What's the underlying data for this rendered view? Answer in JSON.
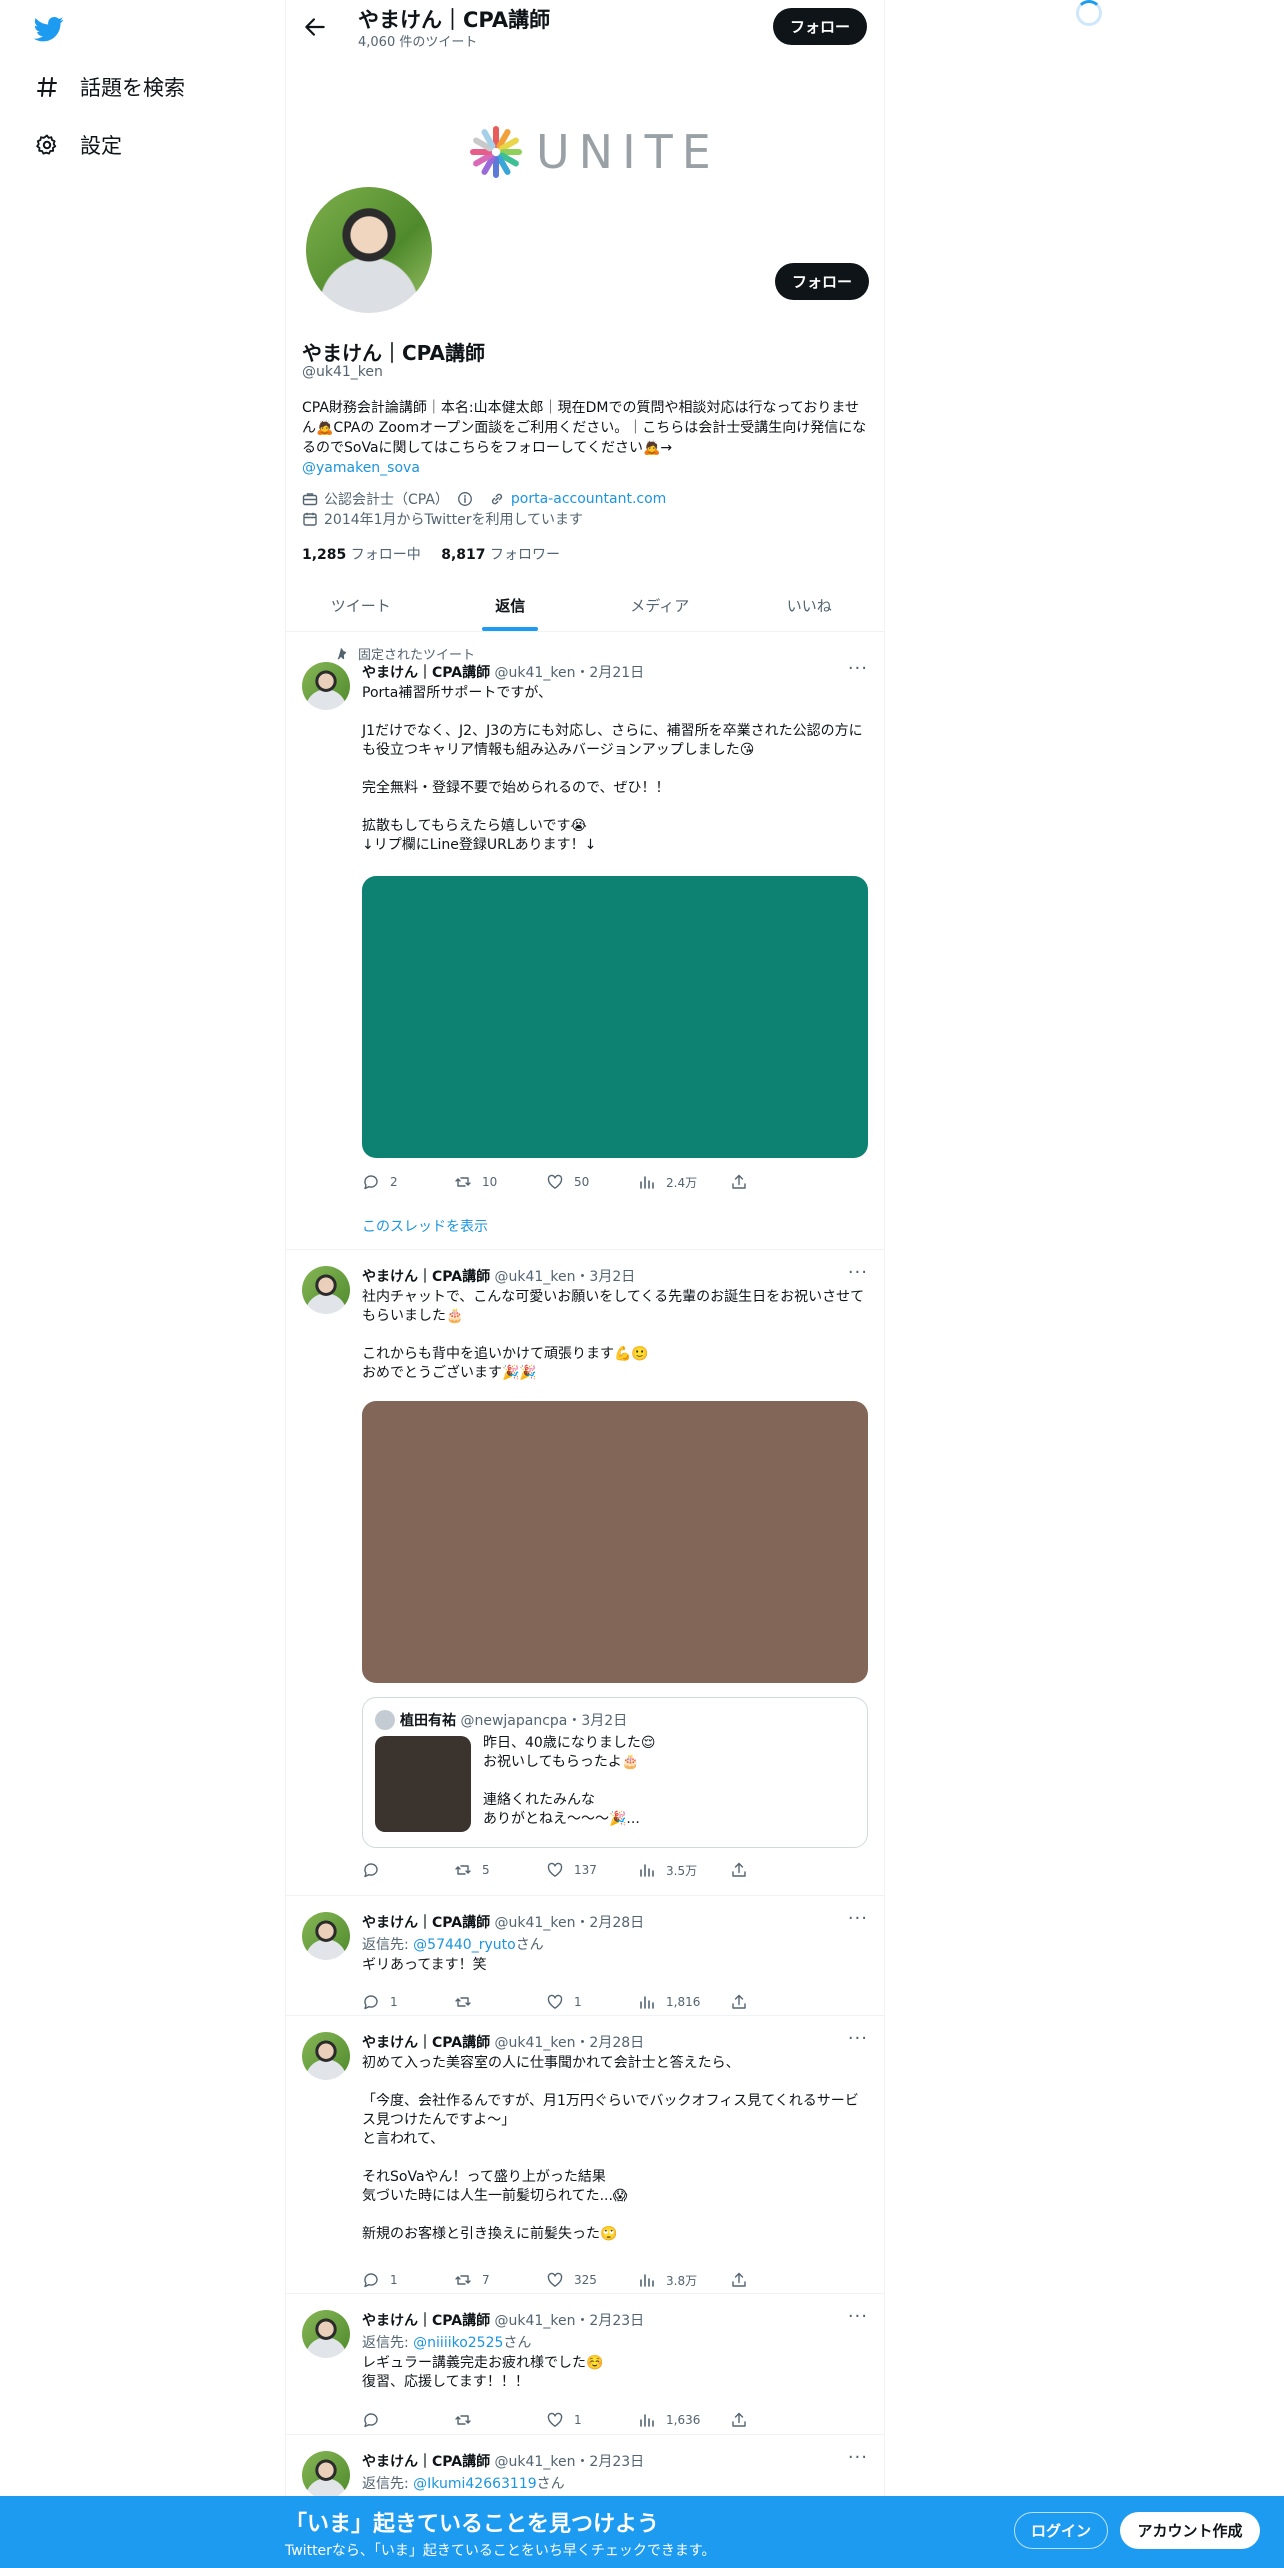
{
  "nav": {
    "explore_label": "話題を検索",
    "settings_label": "設定"
  },
  "header": {
    "title": "やまけん｜CPA講師",
    "tweet_count": "4,060 件のツイート",
    "follow_label": "フォロー"
  },
  "banner": {
    "logo_text": "UNITE"
  },
  "profile": {
    "name": "やまけん｜CPA講師",
    "handle": "@uk41_ken",
    "follow_label": "フォロー",
    "bio": "CPA財務会計論講師｜本名:山本健太郎｜現在DMでの質問や相談対応は行なっておりません🙇CPAの Zoomオープン面談をご利用ください。｜こちらは会計士受講生向け発信になるのでSoVaに関してはこちらをフォローしてください🙇→",
    "bio_mention": "@yamaken_sova",
    "category": "公認会計士（CPA）",
    "website": "porta-accountant.com",
    "joined": "2014年1月からTwitterを利用しています",
    "following_count": "1,285",
    "following_label": "フォロー中",
    "followers_count": "8,817",
    "followers_label": "フォロワー"
  },
  "tabs": [
    "ツイート",
    "返信",
    "メディア",
    "いいね"
  ],
  "active_tab": "返信",
  "tweets": [
    {
      "pinned_label": "固定されたツイート",
      "name": "やまけん｜CPA講師",
      "handle": "@uk41_ken",
      "date": "・2月21日",
      "text": "Porta補習所サポートですが、\n\nJ1だけでなく、J2、J3の方にも対応し、さらに、補習所を卒業された公認の方にも役立つキャリア情報も組み込みバージョンアップしました😘\n\n完全無料・登録不要で始められるので、ぜひ！！\n\n拡散もしてもらえたら嬉しいです😭\n↓リプ欄にLine登録URLあります！↓",
      "media_color": "#0d8273",
      "replies": "2",
      "retweets": "10",
      "likes": "50",
      "views": "2.4万",
      "show_thread": "このスレッドを表示"
    },
    {
      "name": "やまけん｜CPA講師",
      "handle": "@uk41_ken",
      "date": "・3月2日",
      "text": "社内チャットで、こんな可愛いお願いをしてくる先輩のお誕生日をお祝いさせてもらいました🎂\n\nこれからも背中を追いかけて頑張ります💪🙂\nおめでとうございます🎉🎉",
      "media_color": "#826658",
      "quote": {
        "name": "植田有祐",
        "handle": "@newjapancpa",
        "date": "・3月2日",
        "text": "昨日、40歳になりました😌\nお祝いしてもらったよ🎂\n\n連絡くれたみんな\nありがとねえ〜〜〜🎉..."
      },
      "replies": "",
      "retweets": "5",
      "likes": "137",
      "views": "3.5万"
    },
    {
      "name": "やまけん｜CPA講師",
      "handle": "@uk41_ken",
      "date": "・2月28日",
      "reply_prefix": "返信先: ",
      "reply_to": "@57440_ryuto",
      "reply_suffix": "さん",
      "text": "ギリあってます！笑",
      "replies": "1",
      "retweets": "",
      "likes": "1",
      "views": "1,816"
    },
    {
      "name": "やまけん｜CPA講師",
      "handle": "@uk41_ken",
      "date": "・2月28日",
      "text": "初めて入った美容室の人に仕事聞かれて会計士と答えたら、\n\n「今度、会社作るんですが、月1万円ぐらいでバックオフィス見てくれるサービス見つけたんですよ〜」\nと言われて、\n\nそれSoVaやん！って盛り上がった結果\n気づいた時には人生一前髪切られてた...😱\n\n新規のお客様と引き換えに前髪失った🙄",
      "replies": "1",
      "retweets": "7",
      "likes": "325",
      "views": "3.8万"
    },
    {
      "name": "やまけん｜CPA講師",
      "handle": "@uk41_ken",
      "date": "・2月23日",
      "reply_prefix": "返信先: ",
      "reply_to": "@niiiiko2525",
      "reply_suffix": "さん",
      "text": "レギュラー講義完走お疲れ様でした☺️\n復習、応援してます！！！",
      "replies": "",
      "retweets": "",
      "likes": "1",
      "views": "1,636"
    },
    {
      "name": "やまけん｜CPA講師",
      "handle": "@uk41_ken",
      "date": "・2月23日",
      "reply_prefix": "返信先: ",
      "reply_to": "@Ikumi42663119",
      "reply_suffix": "さん"
    }
  ],
  "bottom": {
    "title": "「いま」起きていることを見つけよう",
    "subtitle": "Twitterなら、「いま」起きていることをいち早くチェックできます。",
    "login": "ログイン",
    "signup": "アカウント作成"
  },
  "colors": {
    "accent": "#1d9bf0",
    "link": "#1b95e0",
    "button_dark": "#0f1419"
  }
}
